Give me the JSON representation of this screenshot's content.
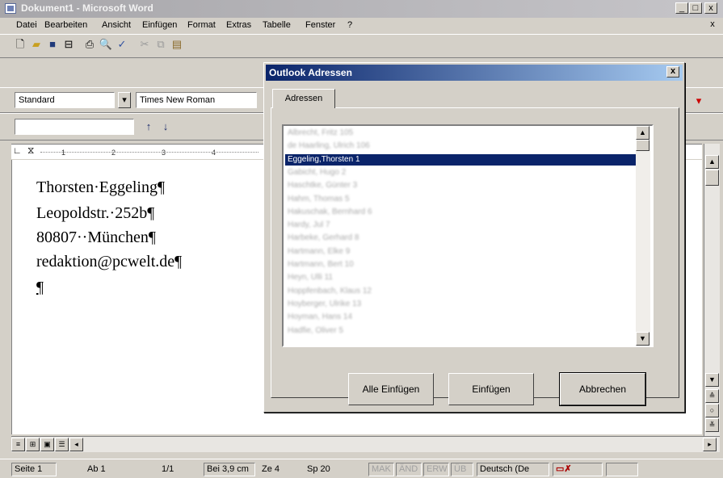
{
  "window": {
    "title": "Dokument1 - Microsoft Word",
    "minimize": "_",
    "maximize": "□",
    "close": "x",
    "doc_close": "x"
  },
  "menu": [
    "Datei",
    "Bearbeiten",
    "Ansicht",
    "Einfügen",
    "Format",
    "Extras",
    "Tabelle",
    "Fenster",
    "?"
  ],
  "format_bar": {
    "style": "Standard",
    "font": "Times New Roman"
  },
  "document": {
    "lines": [
      "Thorsten·Eggeling¶",
      "Leopoldstr.·252b¶",
      "80807··München¶",
      "redaktion@pcwelt.de¶",
      "¶"
    ]
  },
  "ruler": [
    "1",
    "2",
    "3",
    "4"
  ],
  "dialog": {
    "title": "Outlook Adressen",
    "close": "x",
    "tab": "Adressen",
    "list": [
      "Albrecht, Fritz 105",
      "de Haarling, Ulrich 106",
      "Eggeling,Thorsten 1",
      "Gabicht, Hugo 2",
      "Haschtke, Günter 3",
      "Hahm, Thomas 5",
      "Hakuschak, Bernhard 6",
      "Hardy, Jul 7",
      "Harbeke, Gerhard 8",
      "Hartmann, Elke 9",
      "Hartmann, Bert 10",
      "Heyn, Ulli 11",
      "Hoppfenbach, Klaus 12",
      "Hoyberger, Ulrike 13",
      "Hoyman, Hans 14",
      "Hadfie, Oliver 5"
    ],
    "selected_index": 2,
    "buttons": [
      "Alle Einfügen",
      "Einfügen",
      "Abbrechen"
    ]
  },
  "status": {
    "page": "Seite 1",
    "section": "Ab 1",
    "pages": "1/1",
    "position": "Bei 3,9 cm",
    "line": "Ze 4",
    "column": "Sp 20",
    "mak": "MAK",
    "and": "ÄND",
    "erw": "ERW",
    "ub": "ÜB",
    "language": "Deutsch (De"
  },
  "colors": {
    "titlebar_dialog": "#0a246a",
    "selection": "#0a246a"
  }
}
